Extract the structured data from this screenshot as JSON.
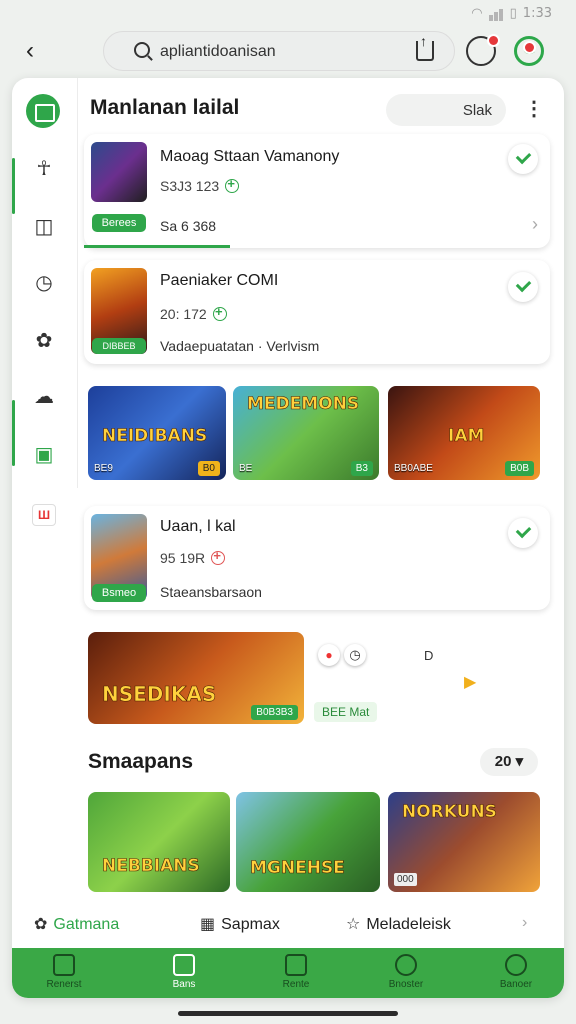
{
  "status": {
    "time": "1:33"
  },
  "topbar": {
    "url": "apliantidoanisan"
  },
  "header": {
    "title": "Manlanan lailal",
    "pill_label": "Slak"
  },
  "cards": [
    {
      "title": "Maoag Sttaan Vamanony",
      "meta": "S3J3 123",
      "tag": "Sa 6 368",
      "tag_left": "Berees"
    },
    {
      "title": "Paeniaker COMI",
      "meta": "20: 172",
      "sub": "Vadaepuatatan · Verlvism",
      "tag_left": "DIBBEB"
    },
    {
      "title": "Uaan, l kal",
      "meta": "95 19R",
      "sub": "Staeansbarsaon",
      "tag_left": "Bsmeo"
    }
  ],
  "carousel": [
    {
      "caption": "NEIDIBANS",
      "label": "BE9",
      "badge": "B0"
    },
    {
      "caption": "MEDEMONS",
      "label": "BE",
      "badge": "B3"
    },
    {
      "caption": "IAM",
      "label": "BB0ABE",
      "badge": "B0B"
    }
  ],
  "promo": {
    "caption": "NSEDIKAS",
    "badge": "B0B3B3",
    "chip": "BEE Mat",
    "letter": "D"
  },
  "section": {
    "title": "Smaapans",
    "count": "20"
  },
  "grid": [
    {
      "caption": "NEBBIANS"
    },
    {
      "caption": "MGNEHSE"
    },
    {
      "caption": "NORKUNS",
      "badge": "000"
    }
  ],
  "bottom_links": {
    "a": "Gatmana",
    "b": "Sapmax",
    "c": "Meladeleisk"
  },
  "nav": [
    "Renerst",
    "Bans",
    "Rente",
    "Bnoster",
    "Banoer"
  ],
  "colors": {
    "accent": "#2fa64a",
    "nav": "#3aa846"
  }
}
